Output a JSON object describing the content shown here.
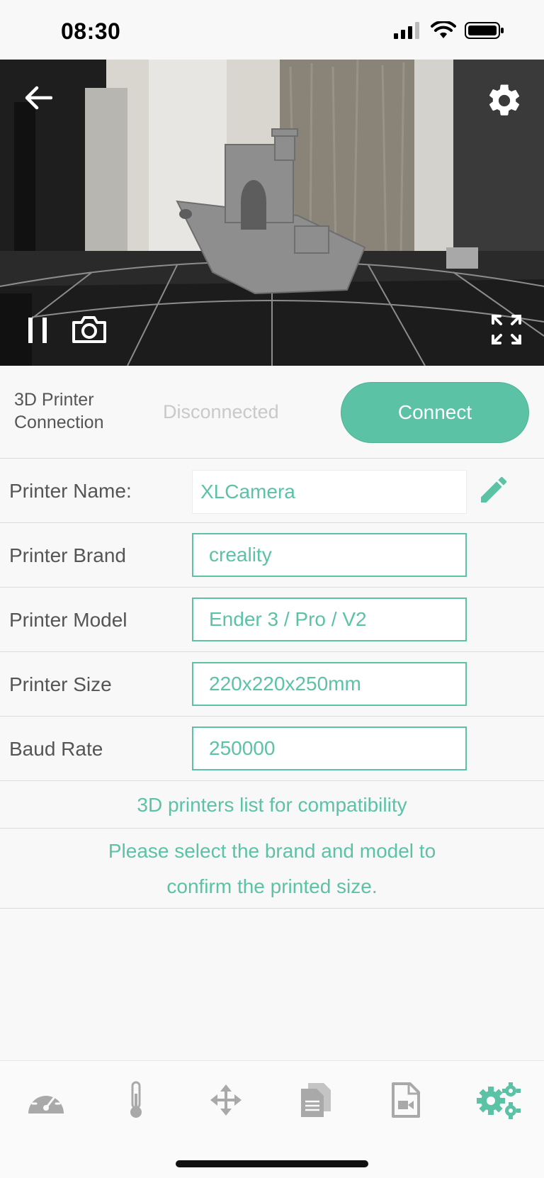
{
  "status_bar": {
    "time": "08:30"
  },
  "camera": {
    "controls": {
      "back": "back-arrow-icon",
      "settings": "gear-icon",
      "pause": "pause-icon",
      "snapshot": "camera-icon",
      "fullscreen": "fullscreen-icon"
    }
  },
  "connection": {
    "label": "3D Printer Connection",
    "status": "Disconnected",
    "button_label": "Connect"
  },
  "fields": [
    {
      "label": "Printer Name:",
      "value": "XLCamera"
    },
    {
      "label": "Printer Brand",
      "value": "creality"
    },
    {
      "label": "Printer Model",
      "value": "Ender 3 / Pro / V2"
    },
    {
      "label": "Printer Size",
      "value": "220x220x250mm"
    },
    {
      "label": "Baud Rate",
      "value": "250000"
    }
  ],
  "compat_link": "3D printers list for compatibility",
  "note": "Please select the brand and model to confirm the printed size.",
  "tabs": [
    {
      "icon": "dashboard-gauge-icon",
      "active": false
    },
    {
      "icon": "thermometer-icon",
      "active": false
    },
    {
      "icon": "move-arrows-icon",
      "active": false
    },
    {
      "icon": "files-icon",
      "active": false
    },
    {
      "icon": "video-file-icon",
      "active": false
    },
    {
      "icon": "settings-gears-icon",
      "active": true
    }
  ],
  "colors": {
    "accent": "#5cc2a6",
    "inactive_icon": "#a9a9a9",
    "disconnected_text": "#c9c9c9"
  }
}
